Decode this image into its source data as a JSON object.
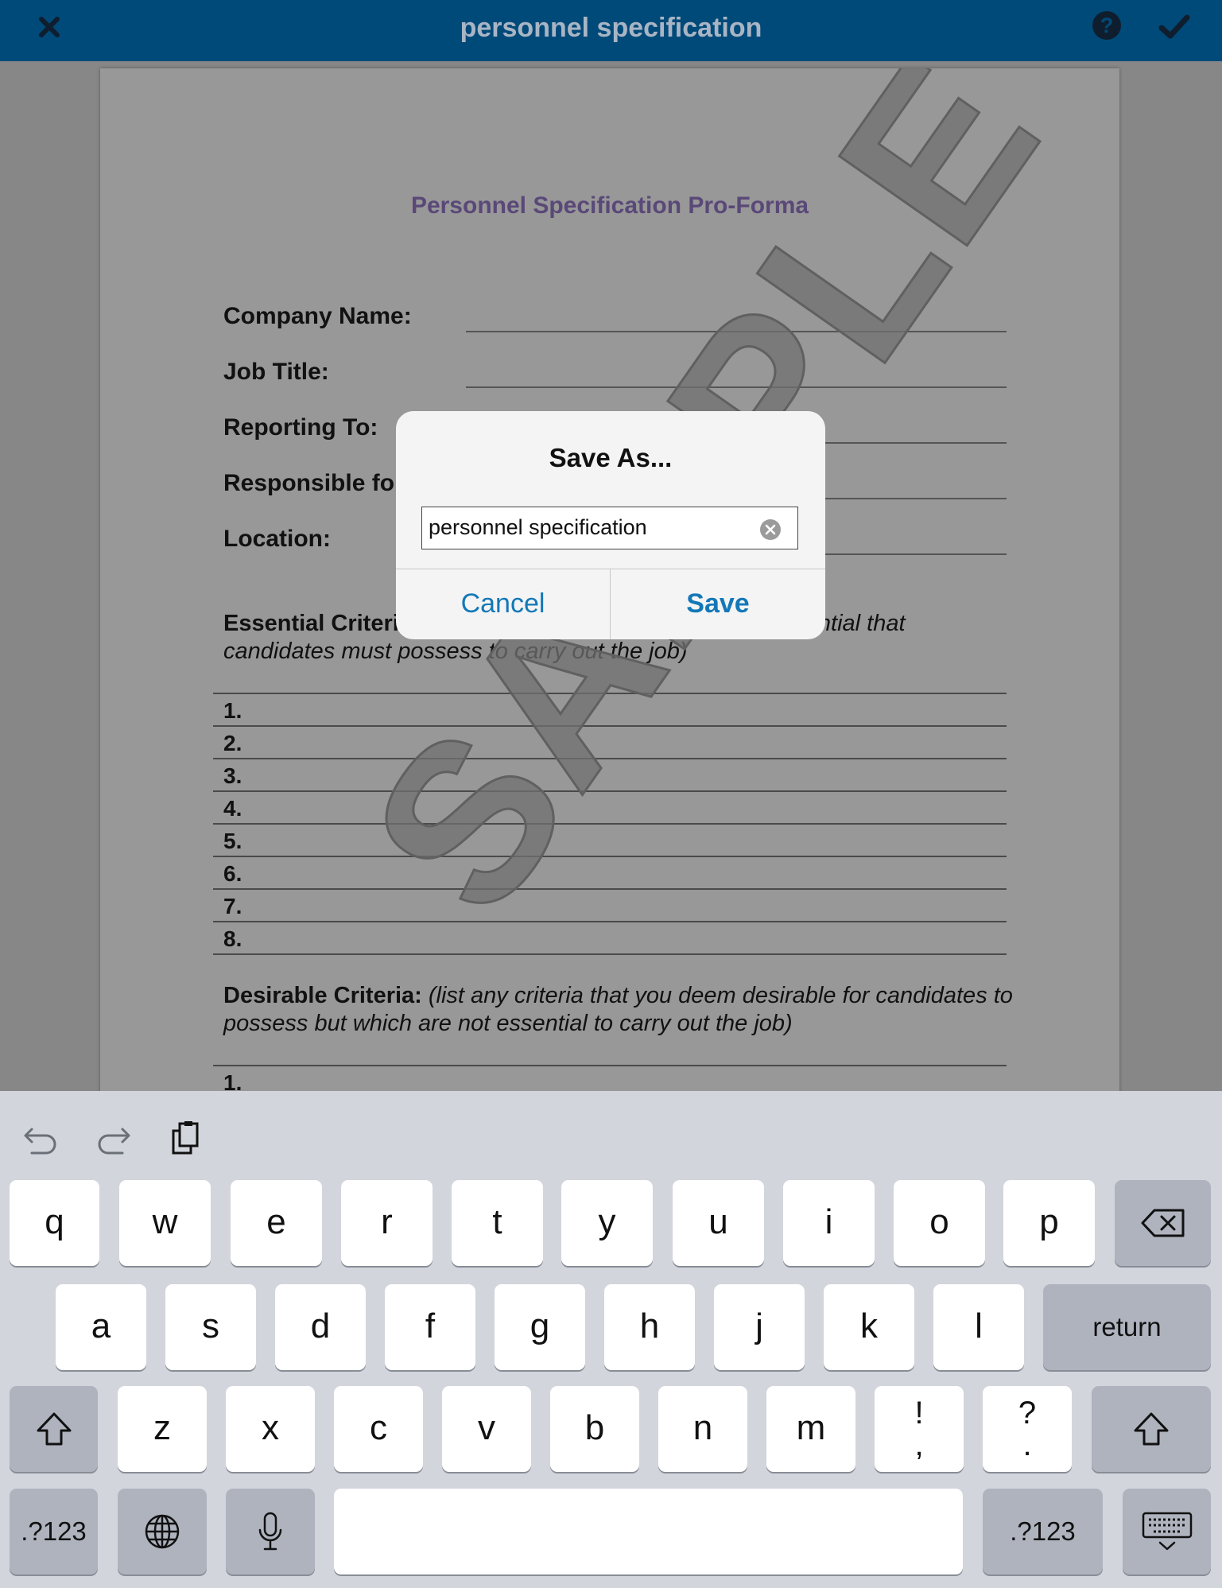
{
  "topbar": {
    "title": "personnel specification",
    "close_icon": "close-icon",
    "help_icon": "help-icon",
    "help_glyph": "?",
    "confirm_icon": "checkmark-icon",
    "background": "#004a79"
  },
  "document": {
    "title": "Personnel Specification Pro-Forma",
    "fields": {
      "company": "Company Name:",
      "job_title": "Job Title:",
      "reporting": "Reporting To:",
      "responsible": "Responsible for:",
      "location": "Location:"
    },
    "essential": {
      "label": "Essential Criteria:",
      "hint": "(list all of those criteria you deem essential that candidates must possess to carry out the job)",
      "items": [
        "1.",
        "2.",
        "3.",
        "4.",
        "5.",
        "6.",
        "7.",
        "8."
      ]
    },
    "desirable": {
      "label": "Desirable Criteria:",
      "hint": "(list any criteria that you deem desirable for candidates to possess but which are not essential to carry out the job)",
      "items": [
        "1."
      ]
    },
    "watermark": "SAMPLE"
  },
  "dialog": {
    "title": "Save As...",
    "filename": "personnel specification",
    "cancel": "Cancel",
    "save": "Save",
    "accent": "#1378b8"
  },
  "keyboard": {
    "toolbar": [
      "undo-icon",
      "redo-icon",
      "paste-icon"
    ],
    "row1": [
      "q",
      "w",
      "e",
      "r",
      "t",
      "y",
      "u",
      "i",
      "o",
      "p"
    ],
    "row2": [
      "a",
      "s",
      "d",
      "f",
      "g",
      "h",
      "j",
      "k",
      "l"
    ],
    "row3": [
      "z",
      "x",
      "c",
      "v",
      "b",
      "n",
      "m"
    ],
    "punct1": [
      "!",
      ","
    ],
    "punct2": [
      "?",
      "."
    ],
    "return": "return",
    "numbers": ".?123"
  }
}
